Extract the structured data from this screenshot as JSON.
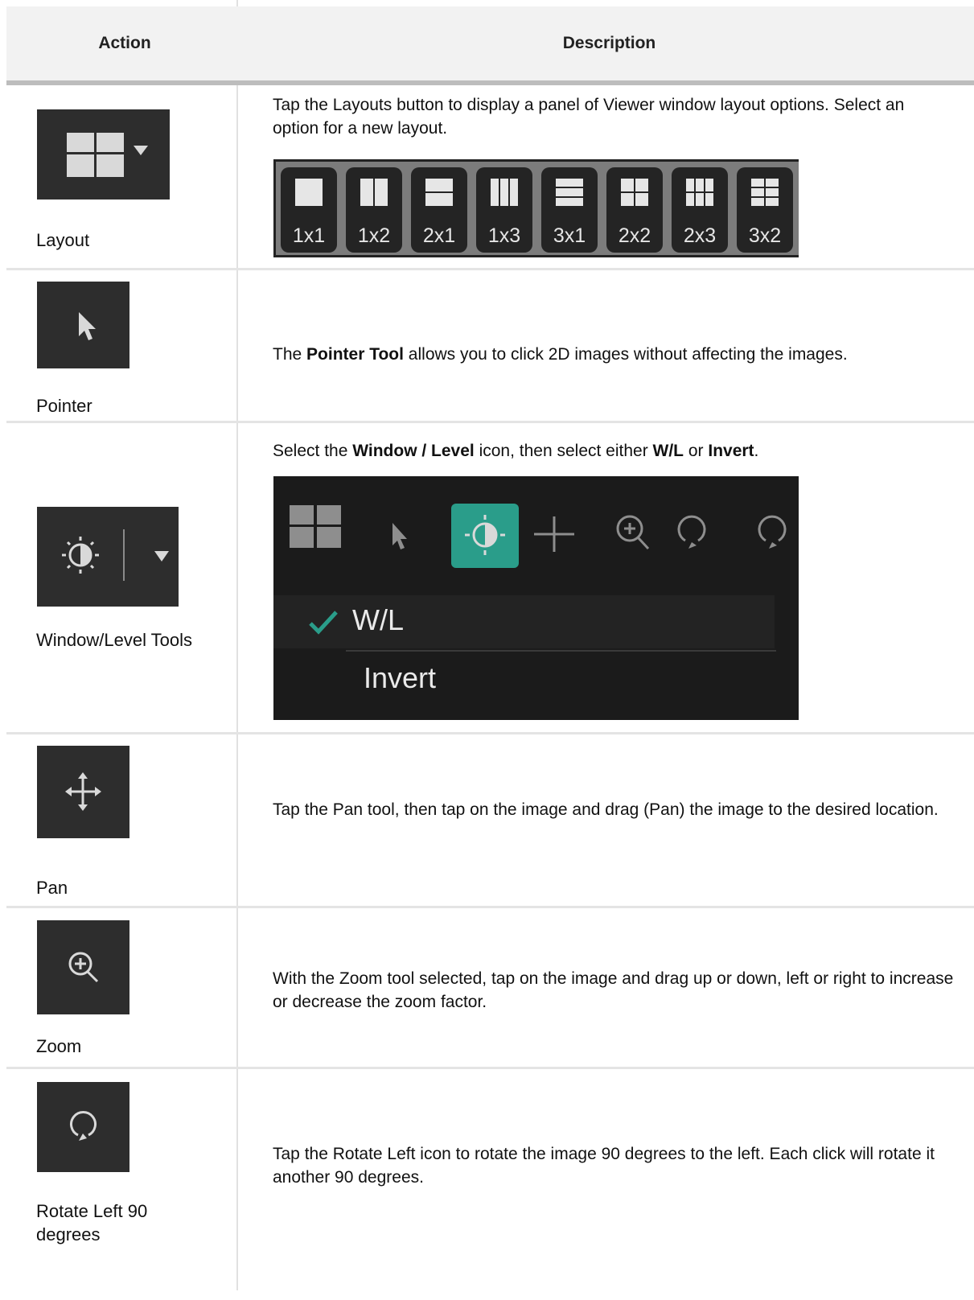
{
  "header": {
    "action": "Action",
    "description": "Description"
  },
  "rows": [
    {
      "label": "Layout",
      "icon": "layout-grid-dropdown-icon",
      "desc_parts": [
        "Tap the Layouts button to display a panel of Viewer window layout options. Select an option for a new layout."
      ],
      "layout_options": [
        "1x1",
        "1x2",
        "2x1",
        "1x3",
        "3x1",
        "2x2",
        "2x3",
        "3x2"
      ]
    },
    {
      "label": "Pointer",
      "icon": "pointer-arrow-icon",
      "desc_parts": [
        "The ",
        "Pointer Tool",
        " allows you to click 2D images without affecting the images."
      ]
    },
    {
      "label": "Window/Level Tools",
      "icon": "window-level-sun-icon",
      "desc_parts": [
        "Select the ",
        "Window / Level",
        " icon, then select either ",
        "W/L",
        " or ",
        "Invert",
        "."
      ],
      "menu": {
        "checked_item": "W/L",
        "second_item": "Invert"
      },
      "accent_color": "#2a9d8a"
    },
    {
      "label": "Pan",
      "icon": "pan-arrows-icon",
      "desc_parts": [
        "Tap the Pan tool, then tap on the image and drag (Pan) the image to the desired location."
      ]
    },
    {
      "label": "Zoom",
      "icon": "zoom-magnifier-icon",
      "desc_parts": [
        "With the Zoom tool selected, tap on the image and drag up or down, left or right to increase or decrease the zoom factor."
      ]
    },
    {
      "label": "Rotate Left 90 degrees",
      "icon": "rotate-left-icon",
      "desc_parts": [
        "Tap the Rotate Left icon to rotate the image 90 degrees to the left. Each click will rotate it another 90 degrees."
      ]
    }
  ]
}
